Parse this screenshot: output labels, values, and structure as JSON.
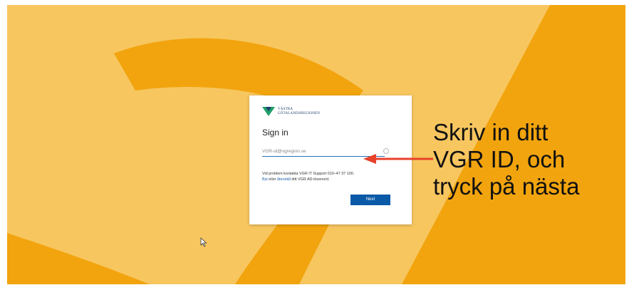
{
  "colors": {
    "background_accent": "#f2a40e",
    "light_swirl": "#f7c65f",
    "primary_button": "#0b5aa7",
    "arrow": "#e8412a"
  },
  "signin": {
    "logo_text_line1": "VÄSTRA",
    "logo_text_line2": "GÖTALANDSREGIONEN",
    "title": "Sign in",
    "email_placeholder": "VGR-id@vgregion.se",
    "help_text": "Vid problem kontakta VGR IT Support 010–47 37 100.",
    "help_link1": "Byt",
    "help_mid": "eller",
    "help_link2": "återställ",
    "help_end": "ditt VGR AD-lösenord.",
    "next_label": "Next"
  },
  "annotation": {
    "line1": "Skriv in ditt",
    "line2": "VGR ID, och",
    "line3": "tryck på nästa"
  },
  "icons": [
    "vgr-logo-icon",
    "field-info-icon",
    "arrow-icon",
    "mouse-cursor-icon"
  ]
}
